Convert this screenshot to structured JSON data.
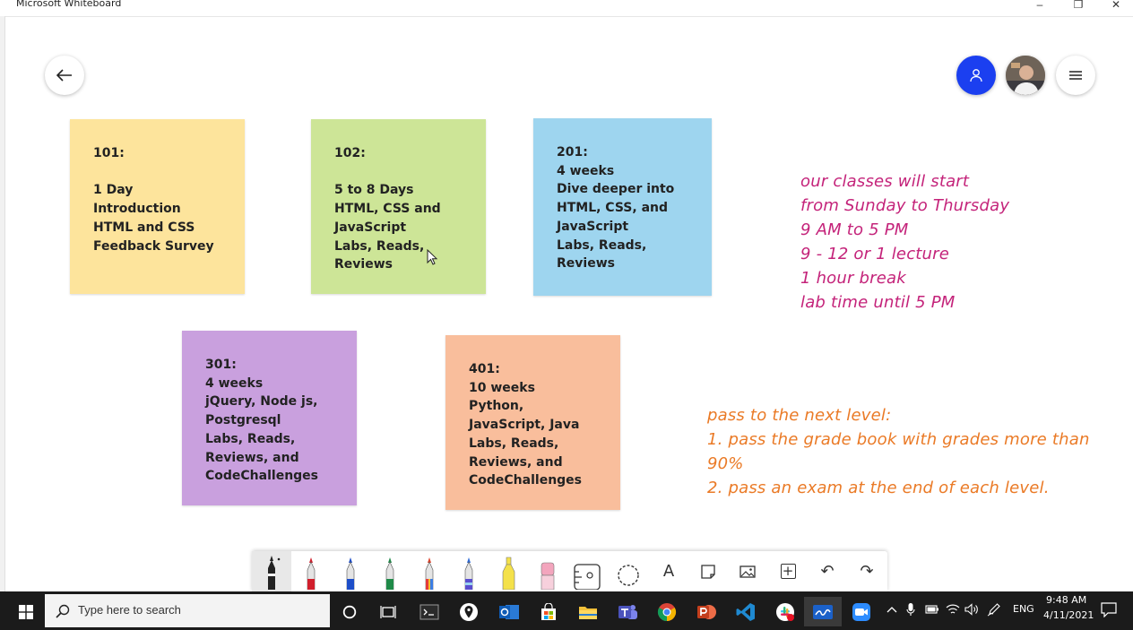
{
  "window": {
    "title": "Microsoft Whiteboard",
    "minimize_glyph": "–",
    "maximize_glyph": "❐",
    "close_glyph": "✕"
  },
  "canvas": {
    "notes": [
      {
        "text": "101:\n\n1 Day\nIntroduction\nHTML and CSS\nFeedback Survey",
        "color": "#fde49c"
      },
      {
        "text": "102:\n\n5 to 8 Days\nHTML, CSS and\nJavaScript\nLabs, Reads,\nReviews",
        "color": "#cde597"
      },
      {
        "text": "201:\n4 weeks\nDive deeper into\nHTML, CSS, and\nJavaScript\nLabs, Reads,\nReviews",
        "color": "#9ed5ef"
      },
      {
        "text": "301:\n4 weeks\njQuery, Node js,\nPostgresql\nLabs, Reads,\nReviews, and\nCodeChallenges",
        "color": "#c9a0de"
      },
      {
        "text": "401:\n10 weeks\nPython,\nJavaScript, Java\nLabs, Reads,\nReviews,  and\nCodeChallenges",
        "color": "#f9be9c"
      }
    ],
    "schedule_lines": [
      "our classes will start",
      "from Sunday to Thursday",
      "9 AM to 5 PM",
      "9 - 12 or 1 lecture",
      "1 hour break",
      "lab time until 5 PM"
    ],
    "pass_lines": [
      "pass to the next level:",
      "1. pass the grade book with grades more than",
      "90%",
      "2. pass an exam at the end of each level."
    ],
    "colors": {
      "schedule_ink": "#c4237a",
      "pass_ink": "#ea7a26"
    }
  },
  "toolbar": {
    "tools": [
      "black-pen",
      "red-pen",
      "blue-pen",
      "green-pen",
      "rainbow-pen",
      "galaxy-pen",
      "highlighter",
      "eraser",
      "ruler",
      "lasso",
      "text",
      "sticky-note",
      "image",
      "insert",
      "undo",
      "redo"
    ],
    "text_tool_glyph": "A",
    "insert_glyph": "+",
    "undo_glyph": "↶",
    "redo_glyph": "↷"
  },
  "taskbar": {
    "search_placeholder": "Type here to search",
    "language": "ENG",
    "time": "9:48 AM",
    "date": "4/11/2021"
  }
}
